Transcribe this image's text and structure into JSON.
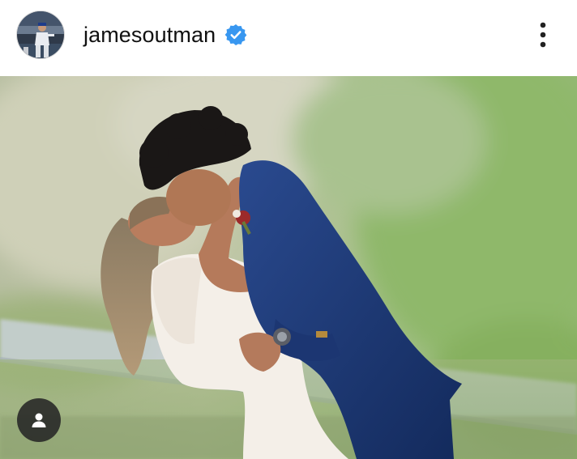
{
  "post": {
    "username": "jamesoutman",
    "verified": true,
    "avatar_icon": "profile-avatar-baseball-player",
    "verified_icon": "verified-badge-icon",
    "more_icon": "more-vertical-icon",
    "tag_icon": "user-tag-icon"
  },
  "colors": {
    "verified_blue": "#3897f0",
    "text": "#111111",
    "tag_button_bg": "#262626"
  }
}
